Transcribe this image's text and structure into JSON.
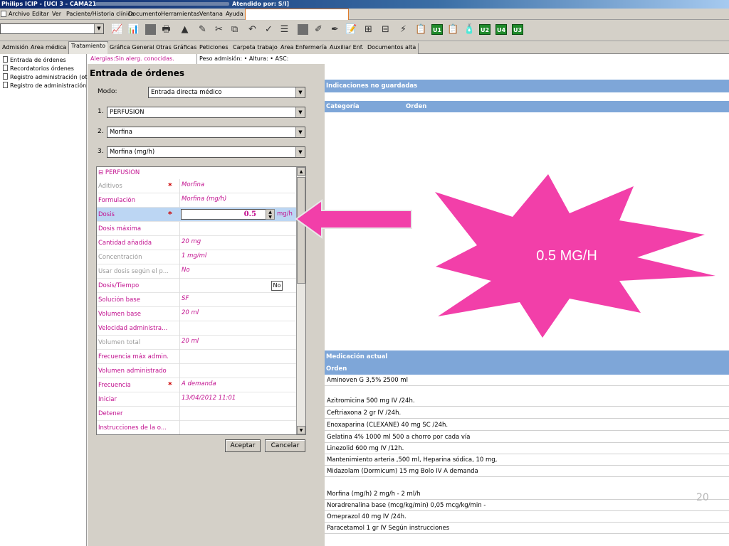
{
  "window": {
    "title": "Philips ICIP - [UCI 3 - CAMA21 -",
    "attended": "Atendido por: S/I]"
  },
  "menu": [
    "Archivo",
    "Editar",
    "Ver",
    "Paciente/Historia clínica",
    "Documento",
    "Herramientas",
    "Ventana",
    "Ayuda"
  ],
  "toolbar": {
    "u_buttons": [
      "U1",
      "U2",
      "U4",
      "U3"
    ]
  },
  "tabs": [
    "Admisión",
    "Area médica",
    "Tratamiento",
    "Gráfica General",
    "Otras Gráficas",
    "Peticiones",
    "Carpeta trabajo",
    "Area Enfermería",
    "Auxiliar Enf.",
    "Documentos alta"
  ],
  "active_tab": "Tratamiento",
  "tree": [
    "Entrada de órdenes",
    "Recordatorios órdenes",
    "Registro administración (ot",
    "Registro de administración"
  ],
  "infobar": {
    "allergy": "Alergias:Sin alerg. conocidas.",
    "admission": "Peso admisión:  •  Altura:  •  ASC:"
  },
  "form": {
    "title": "Entrada de órdenes",
    "mode_label": "Modo:",
    "mode_value": "Entrada directa médico",
    "step1_label": "1.",
    "step1_value": "PERFUSION",
    "step2_label": "2.",
    "step2_value": "Morfina",
    "step3_label": "3.",
    "step3_value": "Morfina (mg/h)",
    "section": "PERFUSION",
    "rows": [
      {
        "name": "Aditivos",
        "value": "Morfina",
        "required": "*"
      },
      {
        "name": "Formulación",
        "value": "Morfina (mg/h)",
        "required": ""
      },
      {
        "name": "Dosis",
        "value": "",
        "required": "*"
      },
      {
        "name": "Dosis máxima",
        "value": "",
        "required": ""
      },
      {
        "name": "Cantidad añadida",
        "value": "20 mg",
        "required": ""
      },
      {
        "name": "Concentración",
        "value": "1 mg/ml",
        "required": ""
      },
      {
        "name": "Usar dosis según el p...",
        "value": "No",
        "required": ""
      },
      {
        "name": "Dosis/Tiempo",
        "value": "",
        "required": ""
      },
      {
        "name": "Solución base",
        "value": "SF",
        "required": ""
      },
      {
        "name": "Volumen base",
        "value": "20 ml",
        "required": ""
      },
      {
        "name": "Velocidad administra...",
        "value": "",
        "required": ""
      },
      {
        "name": "Volumen total",
        "value": "20 ml",
        "required": ""
      },
      {
        "name": "Frecuencia máx admin.",
        "value": "",
        "required": ""
      },
      {
        "name": "Volumen administrado",
        "value": "",
        "required": ""
      },
      {
        "name": "Frecuencia",
        "value": "A demanda",
        "required": "*"
      },
      {
        "name": "Iniciar",
        "value": "13/04/2012 11:01",
        "required": ""
      },
      {
        "name": "Detener",
        "value": "",
        "required": ""
      },
      {
        "name": "Instrucciones de la o...",
        "value": "",
        "required": ""
      }
    ],
    "dose_value": "0.5",
    "dose_unit": "mg/h",
    "dosis_tiempo_value": "No",
    "accept_label": "Aceptar",
    "cancel_label": "Cancelar"
  },
  "right": {
    "pending_header": "Indicaciones no guardadas",
    "col_category": "Categoría",
    "col_order": "Orden",
    "current_header": "Medicación actual",
    "current_col": "Orden",
    "meds": [
      "Aminoven G 3,5% 2500 ml",
      "Azitromicina 500 mg IV /24h.",
      "Ceftriaxona 2 gr IV /24h.",
      "Enoxaparina (CLEXANE) 40 mg SC /24h.",
      "Gelatina 4% 1000 ml 500 a chorro por cada vía",
      "Linezolid 600 mg IV /12h.",
      "Mantenimiento arteria ,500 ml, Heparina sódica, 10 mg,",
      "Midazolam (Dormicum) 15 mg Bolo IV A demanda",
      "Morfina (mg/h) 2 mg/h - 2 ml/h",
      "Noradrenalina base (mcg/kg/min) 0,05 mcg/kg/min -",
      "Omeprazol 40 mg IV /24h.",
      "Paracetamol 1 gr IV Según instrucciones"
    ]
  },
  "callout": {
    "text": "0.5 MG/H",
    "color": "#f23fa9"
  },
  "slide_number": "20"
}
